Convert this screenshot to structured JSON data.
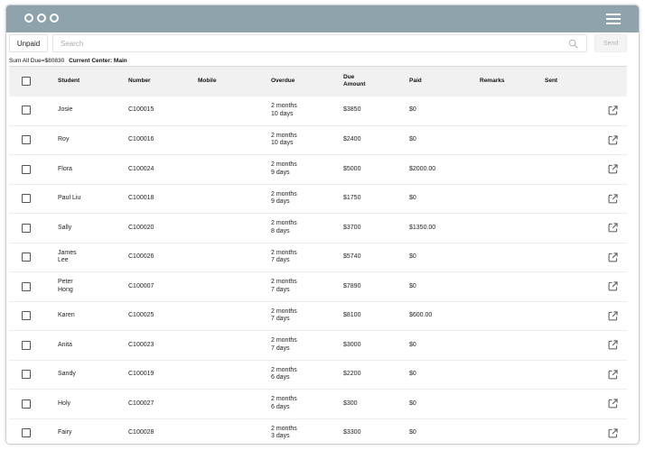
{
  "toolbar": {
    "unpaid_label": "Unpaid",
    "search_placeholder": "Search",
    "send_label": "Send"
  },
  "summary": {
    "sum_text": "Sum All Due=$80830",
    "center_text": "Current Center: Main"
  },
  "table": {
    "headers": {
      "student": "Student",
      "number": "Number",
      "mobile": "Mobile",
      "overdue": "Overdue",
      "due_amount_1": "Due",
      "due_amount_2": "Amount",
      "paid": "Paid",
      "remarks": "Remarks",
      "sent": "Sent"
    },
    "rows": [
      {
        "student1": "Josie",
        "student2": "",
        "number": "C100015",
        "mobile": "",
        "overdue1": "2 months",
        "overdue2": "10 days",
        "due": "$3850",
        "paid": "$0",
        "remarks": "",
        "sent": ""
      },
      {
        "student1": "Roy",
        "student2": "",
        "number": "C100016",
        "mobile": "",
        "overdue1": "2 months",
        "overdue2": "10 days",
        "due": "$2400",
        "paid": "$0",
        "remarks": "",
        "sent": ""
      },
      {
        "student1": "Flora",
        "student2": "",
        "number": "C100024",
        "mobile": "",
        "overdue1": "2 months",
        "overdue2": "9 days",
        "due": "$5000",
        "paid": "$2000.00",
        "remarks": "",
        "sent": ""
      },
      {
        "student1": "Paul Liu",
        "student2": "",
        "number": "C100018",
        "mobile": "",
        "overdue1": "2 months",
        "overdue2": "9 days",
        "due": "$1750",
        "paid": "$0",
        "remarks": "",
        "sent": ""
      },
      {
        "student1": "Sally",
        "student2": "",
        "number": "C100020",
        "mobile": "",
        "overdue1": "2 months",
        "overdue2": "8 days",
        "due": "$3700",
        "paid": "$1350.00",
        "remarks": "",
        "sent": ""
      },
      {
        "student1": "James",
        "student2": "Lee",
        "number": "C100026",
        "mobile": "",
        "overdue1": "2 months",
        "overdue2": "7 days",
        "due": "$5740",
        "paid": "$0",
        "remarks": "",
        "sent": ""
      },
      {
        "student1": "Peter",
        "student2": "Hong",
        "number": "C100007",
        "mobile": "",
        "overdue1": "2 months",
        "overdue2": "7 days",
        "due": "$7890",
        "paid": "$0",
        "remarks": "",
        "sent": ""
      },
      {
        "student1": "Karen",
        "student2": "",
        "number": "C100025",
        "mobile": "",
        "overdue1": "2 months",
        "overdue2": "7 days",
        "due": "$8100",
        "paid": "$600.00",
        "remarks": "",
        "sent": ""
      },
      {
        "student1": "Anita",
        "student2": "",
        "number": "C100023",
        "mobile": "",
        "overdue1": "2 months",
        "overdue2": "7 days",
        "due": "$3000",
        "paid": "$0",
        "remarks": "",
        "sent": ""
      },
      {
        "student1": "Sandy",
        "student2": "",
        "number": "C100019",
        "mobile": "",
        "overdue1": "2 months",
        "overdue2": "6 days",
        "due": "$2200",
        "paid": "$0",
        "remarks": "",
        "sent": ""
      },
      {
        "student1": "Holy",
        "student2": "",
        "number": "C100027",
        "mobile": "",
        "overdue1": "2 months",
        "overdue2": "6 days",
        "due": "$300",
        "paid": "$0",
        "remarks": "",
        "sent": ""
      },
      {
        "student1": "Fairy",
        "student2": "",
        "number": "C100028",
        "mobile": "",
        "overdue1": "2 months",
        "overdue2": "3 days",
        "due": "$3300",
        "paid": "$0",
        "remarks": "",
        "sent": ""
      }
    ]
  },
  "colors": {
    "titlebar": "#8fa3ac",
    "header_row": "#f1f1f1"
  },
  "icons": {
    "window_controls": "circle-icon",
    "menu": "hamburger-menu-icon",
    "search": "search-icon",
    "row_action": "external-link-icon"
  }
}
